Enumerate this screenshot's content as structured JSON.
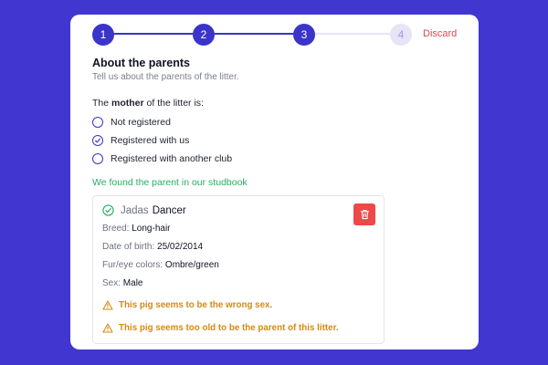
{
  "stepper": {
    "steps": [
      {
        "label": "1",
        "state": "done"
      },
      {
        "label": "2",
        "state": "done"
      },
      {
        "label": "3",
        "state": "done"
      },
      {
        "label": "4",
        "state": "todo"
      }
    ],
    "discard_label": "Discard"
  },
  "section": {
    "title": "About the parents",
    "subtitle": "Tell us about the parents of the litter."
  },
  "question": {
    "prefix": "The ",
    "emphasis": "mother",
    "suffix": " of the litter is:"
  },
  "options": [
    {
      "label": "Not registered",
      "selected": false
    },
    {
      "label": "Registered with us",
      "selected": true
    },
    {
      "label": "Registered with another club",
      "selected": false
    }
  ],
  "found_message": "We found the parent in our studbook",
  "parent": {
    "first_name": "Jadas",
    "last_name": "Dancer",
    "attributes": [
      {
        "label": "Breed: ",
        "value": "Long-hair"
      },
      {
        "label": "Date of birth: ",
        "value": "25/02/2014"
      },
      {
        "label": "Fur/eye colors: ",
        "value": "Ombre/green"
      },
      {
        "label": "Sex: ",
        "value": "Male"
      }
    ],
    "warnings": [
      "This pig seems to be the wrong sex.",
      "This pig seems too old to be the parent of this litter."
    ]
  },
  "colors": {
    "background": "#4136cf",
    "accent": "#3b34c9",
    "success": "#27ae60",
    "danger": "#ef4848",
    "warning": "#d48a11"
  },
  "icons": {
    "selected_radio": "check-icon",
    "parent_status": "check-circle-icon",
    "delete": "trash-icon",
    "warning": "warning-triangle-icon"
  }
}
